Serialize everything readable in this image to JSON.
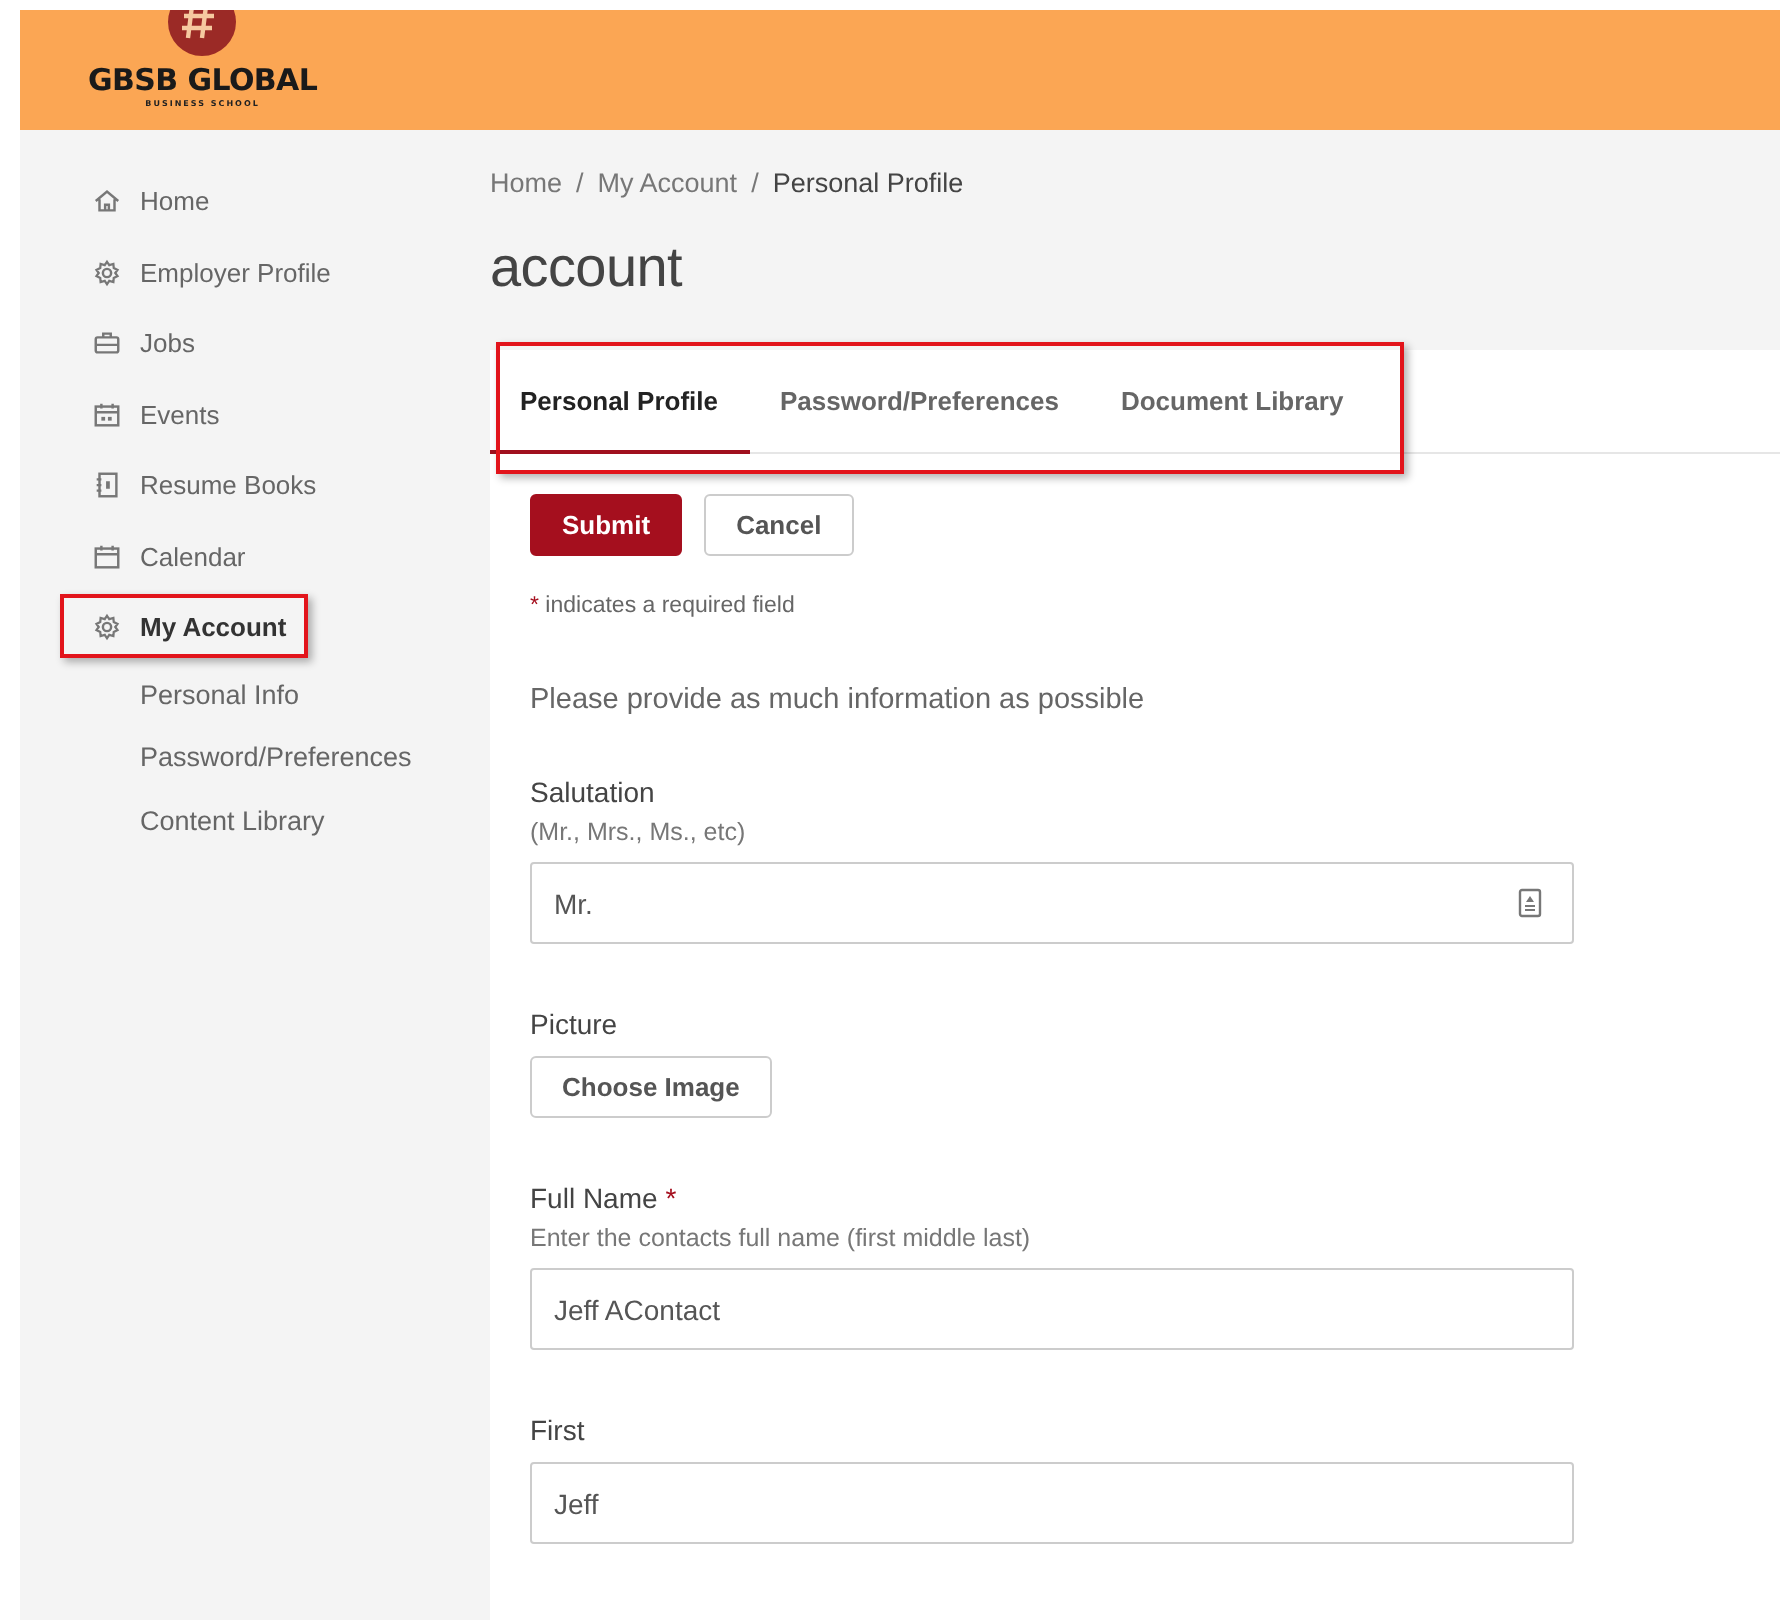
{
  "header": {
    "logo": {
      "name": "GBSB GLOBAL",
      "tagline": "BUSINESS SCHOOL"
    }
  },
  "sidebar": {
    "items": [
      {
        "label": "Home",
        "kind": "home",
        "selected": false,
        "highlighted": false
      },
      {
        "label": "Employer Profile",
        "kind": "gear",
        "selected": false,
        "highlighted": false
      },
      {
        "label": "Jobs",
        "kind": "briefcase",
        "selected": false,
        "highlighted": false
      },
      {
        "label": "Events",
        "kind": "events",
        "selected": false,
        "highlighted": false
      },
      {
        "label": "Resume Books",
        "kind": "book",
        "selected": false,
        "highlighted": false
      },
      {
        "label": "Calendar",
        "kind": "calendar",
        "selected": false,
        "highlighted": false
      },
      {
        "label": "My Account",
        "kind": "gear",
        "selected": true,
        "highlighted": true,
        "children": [
          {
            "label": "Personal Info"
          },
          {
            "label": "Password/Preferences"
          },
          {
            "label": "Content Library"
          }
        ]
      }
    ]
  },
  "breadcrumb": [
    {
      "label": "Home",
      "current": false
    },
    {
      "label": "My Account",
      "current": false
    },
    {
      "label": "Personal Profile",
      "current": true
    }
  ],
  "breadcrumb_separator": "/",
  "page_title": "account",
  "tabs": {
    "highlighted": true,
    "items": [
      {
        "label": "Personal Profile",
        "selected": true
      },
      {
        "label": "Password/Preferences",
        "selected": false
      },
      {
        "label": "Document Library",
        "selected": false
      }
    ]
  },
  "buttons": [
    {
      "label": "Submit",
      "kind": "primary"
    },
    {
      "label": "Cancel",
      "kind": "secondary"
    }
  ],
  "required_note": {
    "mark": "*",
    "text": "indicates a required field"
  },
  "intro": "Please provide as much information as possible",
  "fields": [
    {
      "kind": "text",
      "label": "Salutation",
      "required": false,
      "hint": "(Mr., Mrs., Ms., etc)",
      "value": "Mr.",
      "contact_icon": true
    },
    {
      "kind": "file",
      "label": "Picture",
      "required": false,
      "button": "Choose Image"
    },
    {
      "kind": "text",
      "label": "Full Name",
      "required": true,
      "hint": "Enter the contacts full name (first middle last)",
      "value": "Jeff AContact",
      "contact_icon": false
    },
    {
      "kind": "text",
      "label": "First",
      "required": false,
      "value": "Jeff",
      "contact_icon": false
    }
  ]
}
